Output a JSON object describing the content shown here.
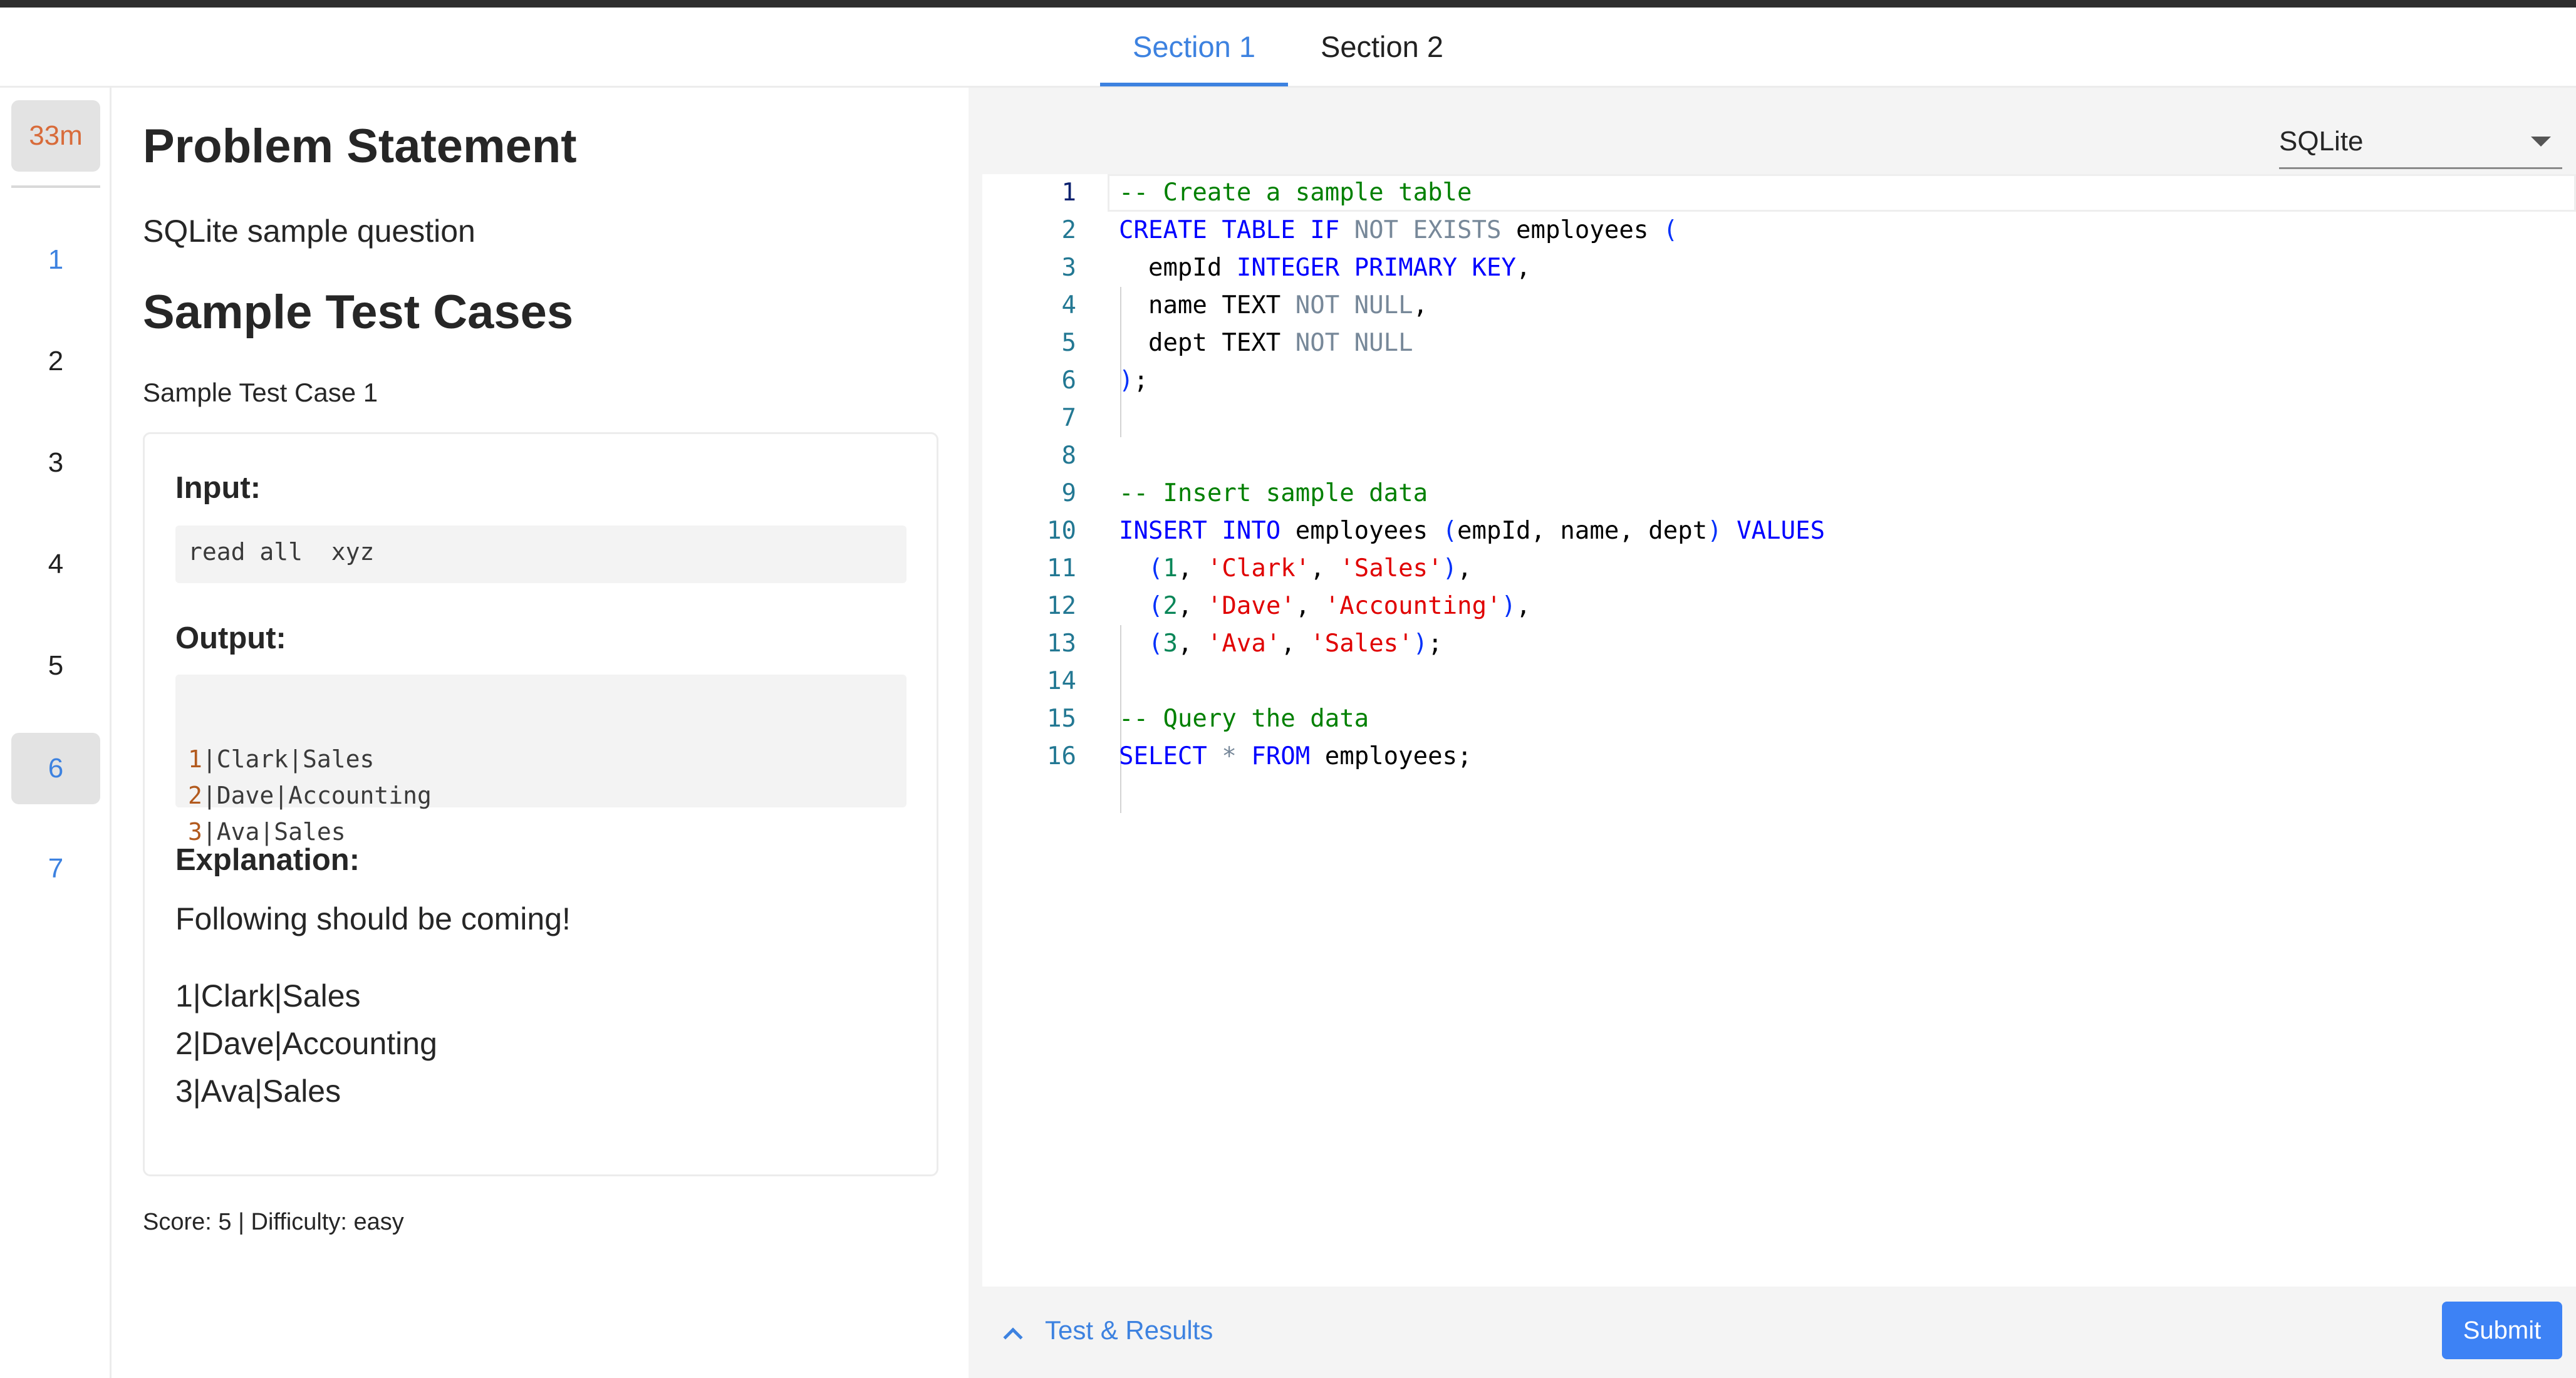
{
  "section_tabs": [
    "Section 1",
    "Section 2"
  ],
  "timer": "33m",
  "question_numbers": [
    "1",
    "2",
    "3",
    "4",
    "5",
    "6",
    "7"
  ],
  "problem": {
    "heading": "Problem Statement",
    "description": "SQLite sample question",
    "sample_heading": "Sample Test Cases",
    "case_title": "Sample Test Case 1",
    "input_label": "Input:",
    "input_value": "read all  xyz",
    "output_label": "Output:",
    "output_lines": [
      {
        "num": "1",
        "rest": "|Clark|Sales"
      },
      {
        "num": "2",
        "rest": "|Dave|Accounting"
      },
      {
        "num": "3",
        "rest": "|Ava|Sales"
      }
    ],
    "explanation_label": "Explanation:",
    "explanation_text": "Following should be coming!",
    "explanation_lines": [
      "1|Clark|Sales",
      "2|Dave|Accounting",
      "3|Ava|Sales"
    ],
    "score_line": "Score: 5 | Difficulty: easy"
  },
  "editor": {
    "language": "SQLite",
    "line_numbers": [
      "1",
      "2",
      "3",
      "4",
      "5",
      "6",
      "7",
      "8",
      "9",
      "10",
      "11",
      "12",
      "13",
      "14",
      "15",
      "16"
    ],
    "lines": [
      [
        {
          "t": "-- Create a sample table",
          "c": "comment"
        }
      ],
      [
        {
          "t": "CREATE TABLE IF ",
          "c": "kw"
        },
        {
          "t": "NOT EXISTS",
          "c": "op"
        },
        {
          "t": " employees ",
          "c": ""
        },
        {
          "t": "(",
          "c": "paren"
        }
      ],
      [
        {
          "t": "  empId ",
          "c": ""
        },
        {
          "t": "INTEGER PRIMARY KEY",
          "c": "kw"
        },
        {
          "t": ",",
          "c": ""
        }
      ],
      [
        {
          "t": "  name TEXT ",
          "c": ""
        },
        {
          "t": "NOT NULL",
          "c": "op"
        },
        {
          "t": ",",
          "c": ""
        }
      ],
      [
        {
          "t": "  dept TEXT ",
          "c": ""
        },
        {
          "t": "NOT NULL",
          "c": "op"
        }
      ],
      [
        {
          "t": ")",
          "c": "paren"
        },
        {
          "t": ";",
          "c": ""
        }
      ],
      [],
      [],
      [
        {
          "t": "-- Insert sample data",
          "c": "comment"
        }
      ],
      [
        {
          "t": "INSERT INTO",
          "c": "kw"
        },
        {
          "t": " employees ",
          "c": ""
        },
        {
          "t": "(",
          "c": "paren"
        },
        {
          "t": "empId, name, dept",
          "c": ""
        },
        {
          "t": ")",
          "c": "paren"
        },
        {
          "t": " VALUES",
          "c": "kw"
        }
      ],
      [
        {
          "t": "  ",
          "c": ""
        },
        {
          "t": "(",
          "c": "paren"
        },
        {
          "t": "1",
          "c": "num"
        },
        {
          "t": ", ",
          "c": ""
        },
        {
          "t": "'Clark'",
          "c": "str"
        },
        {
          "t": ", ",
          "c": ""
        },
        {
          "t": "'Sales'",
          "c": "str"
        },
        {
          "t": ")",
          "c": "paren"
        },
        {
          "t": ",",
          "c": ""
        }
      ],
      [
        {
          "t": "  ",
          "c": ""
        },
        {
          "t": "(",
          "c": "paren"
        },
        {
          "t": "2",
          "c": "num"
        },
        {
          "t": ", ",
          "c": ""
        },
        {
          "t": "'Dave'",
          "c": "str"
        },
        {
          "t": ", ",
          "c": ""
        },
        {
          "t": "'Accounting'",
          "c": "str"
        },
        {
          "t": ")",
          "c": "paren"
        },
        {
          "t": ",",
          "c": ""
        }
      ],
      [
        {
          "t": "  ",
          "c": ""
        },
        {
          "t": "(",
          "c": "paren"
        },
        {
          "t": "3",
          "c": "num"
        },
        {
          "t": ", ",
          "c": ""
        },
        {
          "t": "'Ava'",
          "c": "str"
        },
        {
          "t": ", ",
          "c": ""
        },
        {
          "t": "'Sales'",
          "c": "str"
        },
        {
          "t": ")",
          "c": "paren"
        },
        {
          "t": ";",
          "c": ""
        }
      ],
      [],
      [
        {
          "t": "-- Query the data",
          "c": "comment"
        }
      ],
      [
        {
          "t": "SELECT",
          "c": "kw"
        },
        {
          "t": " * ",
          "c": "op"
        },
        {
          "t": "FROM",
          "c": "kw"
        },
        {
          "t": " employees;",
          "c": ""
        }
      ]
    ]
  },
  "footer": {
    "results_label": "Test & Results",
    "submit_label": "Submit"
  },
  "colors": {
    "accent": "#3d82e0",
    "submit": "#3d82f5",
    "timer": "#d86b3a",
    "selected_bg": "#e3e3e3"
  },
  "icons": [
    "chevron-up-icon",
    "dropdown-caret-icon"
  ]
}
